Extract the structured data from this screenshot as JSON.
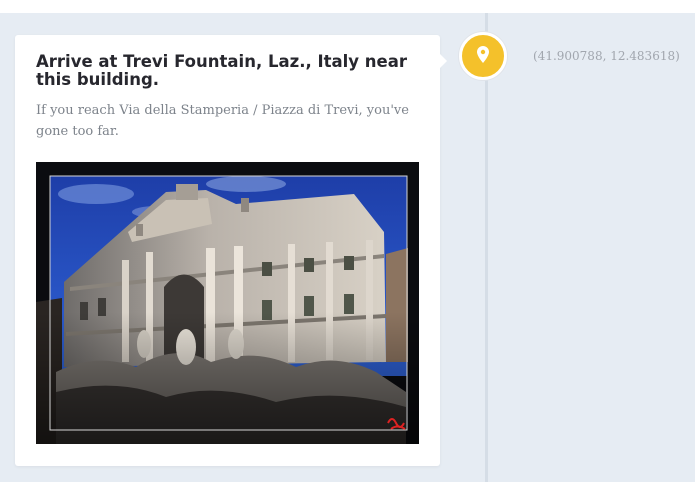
{
  "step": {
    "title": "Arrive at Trevi Fountain, Laz., Italy near this building.",
    "description": "If you reach Via della Stamperia / Piazza di Trevi, you've gone too far.",
    "photo_subject": "Trevi Fountain",
    "coordinates": "(41.900788, 12.483618)"
  },
  "marker": {
    "icon": "map-pin-icon",
    "color": "#f4c12b"
  },
  "colors": {
    "page_background": "#e6ecf3",
    "card_background": "#ffffff",
    "title_text": "#27272e",
    "description_text": "#7d838b",
    "coordinates_text": "#a1a6ae",
    "timeline_line": "#d5dde6"
  }
}
